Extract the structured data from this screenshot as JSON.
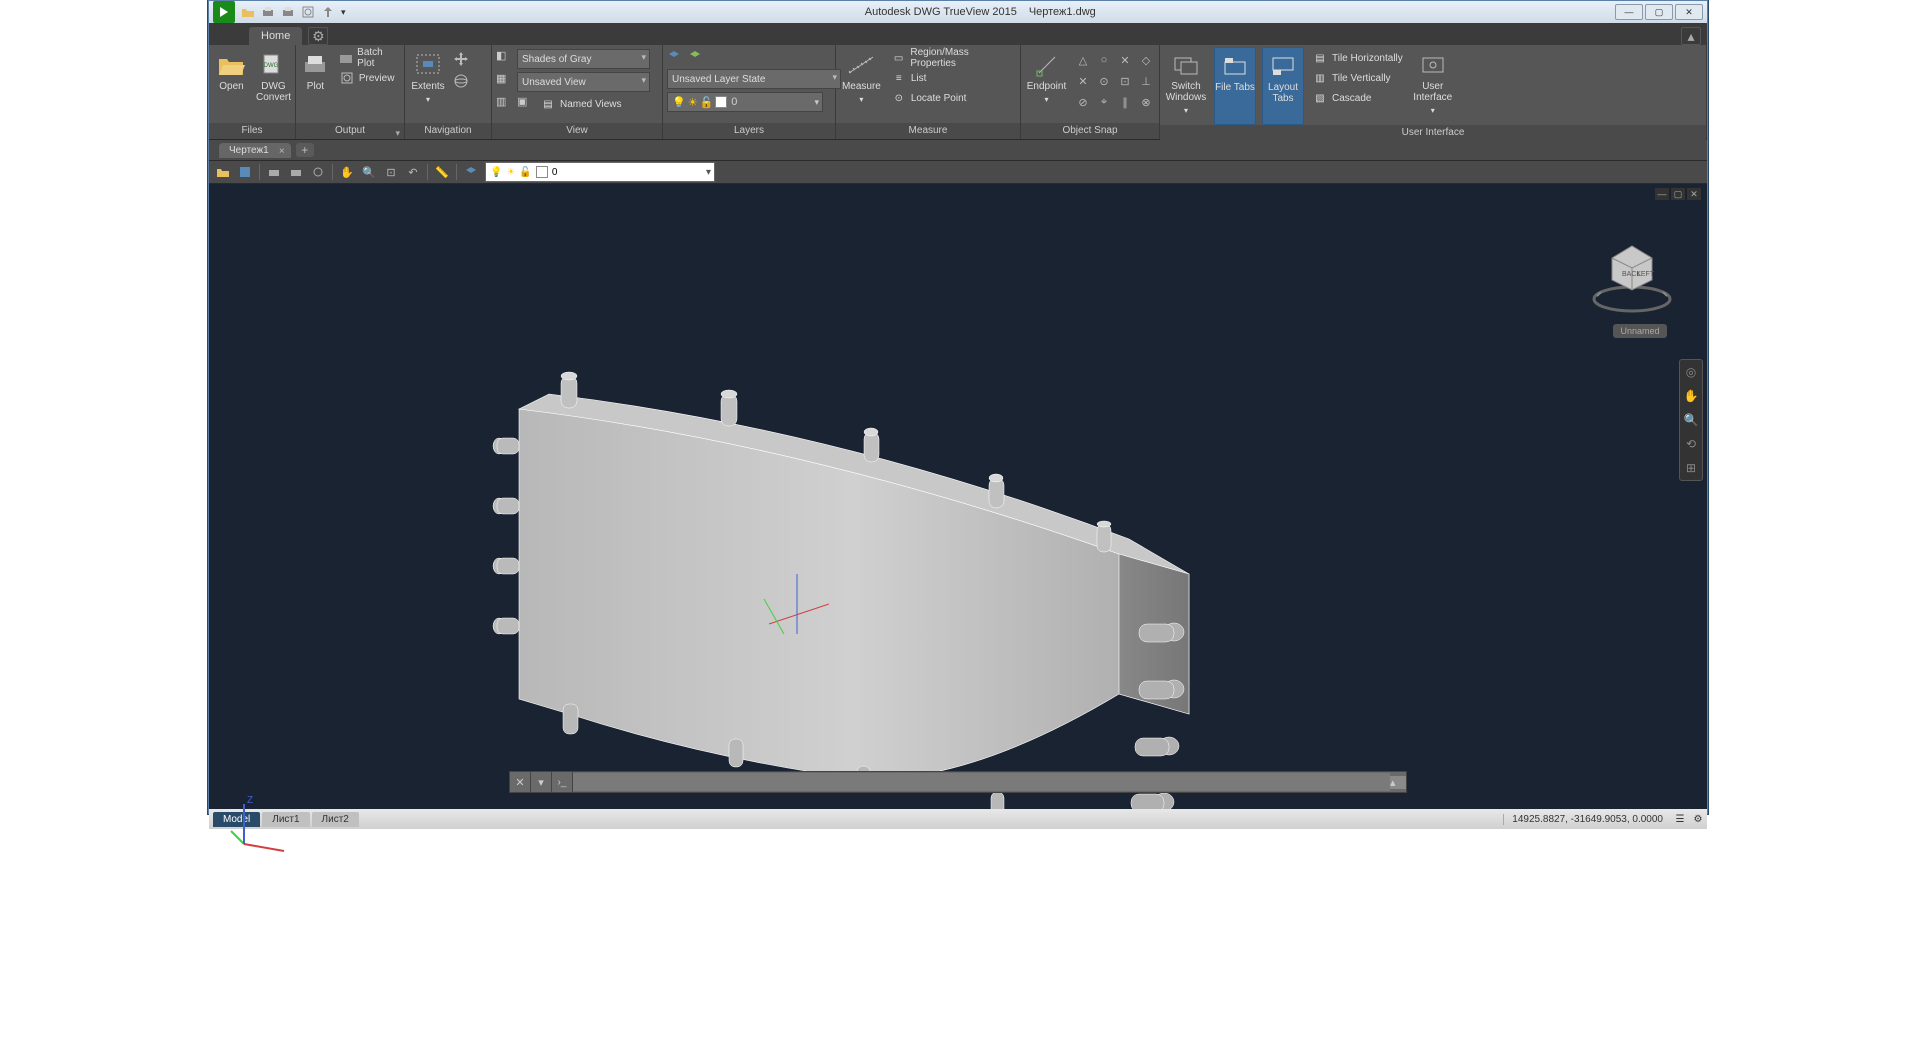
{
  "app": {
    "title_product": "Autodesk DWG TrueView 2015",
    "title_file": "Чертеж1.dwg"
  },
  "ribbon": {
    "tabs": {
      "home": "Home"
    },
    "panels": {
      "files": {
        "label": "Files",
        "open": "Open",
        "dwg_convert": "DWG\nConvert"
      },
      "output": {
        "label": "Output",
        "plot": "Plot",
        "batch_plot": "Batch Plot",
        "preview": "Preview"
      },
      "navigation": {
        "label": "Navigation",
        "extents": "Extents"
      },
      "view": {
        "label": "View",
        "visual_style": "Shades of Gray",
        "saved_view": "Unsaved View",
        "named_views": "Named Views"
      },
      "layers": {
        "label": "Layers",
        "layer_state": "Unsaved Layer State",
        "current_layer": "0"
      },
      "measure": {
        "label": "Measure",
        "measure_btn": "Measure",
        "region": "Region/Mass Properties",
        "list": "List",
        "locate": "Locate Point"
      },
      "osnap": {
        "label": "Object Snap",
        "endpoint": "Endpoint"
      },
      "ui": {
        "label": "User Interface",
        "switch_windows": "Switch\nWindows",
        "file_tabs": "File Tabs",
        "layout_tabs": "Layout\nTabs",
        "tile_h": "Tile Horizontally",
        "tile_v": "Tile Vertically",
        "cascade": "Cascade",
        "user_interface": "User\nInterface"
      }
    }
  },
  "file_tabs": {
    "tab1": "Чертеж1"
  },
  "toolbar2": {
    "layer": "0"
  },
  "viewport": {
    "viewcube_back": "BACK",
    "viewcube_left": "LEFT",
    "unnamed": "Unnamed",
    "ucs_z": "Z"
  },
  "status": {
    "model": "Model",
    "sheet1": "Лист1",
    "sheet2": "Лист2",
    "coords": "14925.8827, -31649.9053, 0.0000"
  }
}
